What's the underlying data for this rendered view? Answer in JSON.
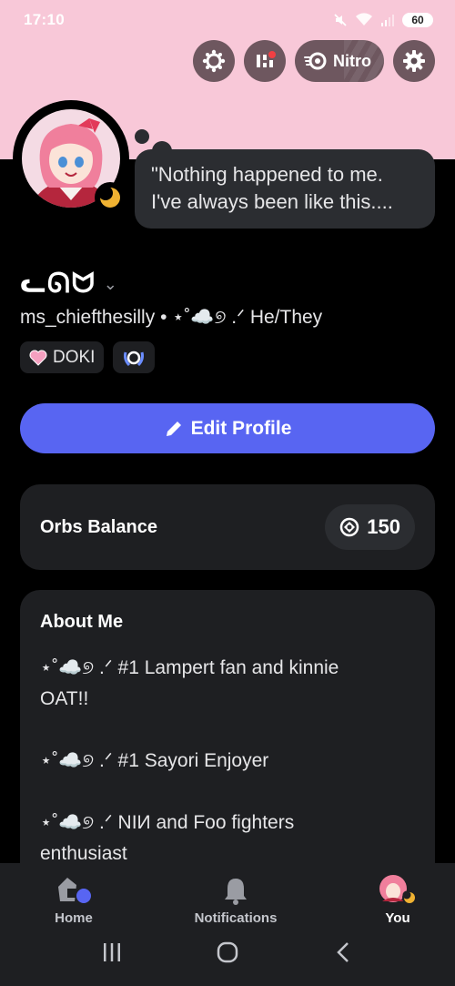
{
  "status_bar": {
    "time": "17:10",
    "battery": "60",
    "icons": [
      "mute-icon",
      "wifi-icon",
      "signal-icon",
      "battery-icon"
    ]
  },
  "header_actions": {
    "nitro_label": "Nitro",
    "icons": [
      "orbs-quest-icon",
      "shop-icon",
      "nitro-icon",
      "settings-icon"
    ]
  },
  "profile": {
    "status_bubble": "\"Nothing happened to me. I've always been like this....",
    "display_name": "ᓚᘏᗢ",
    "username": "ms_chiefthesilly",
    "separator": "•",
    "pronouns": "⋆˚☁️୭ .ᐟ He/They",
    "badges": [
      {
        "label": "DOKI",
        "icon": "heart-icon"
      },
      {
        "label": "",
        "icon": "laurel-badge-icon"
      }
    ],
    "presence": "idle",
    "colors": {
      "banner": "#f8c8d8",
      "accent": "#5865f2",
      "idle": "#f0b232"
    }
  },
  "edit_profile_label": "Edit Profile",
  "orbs": {
    "label": "Orbs Balance",
    "value": "150"
  },
  "about": {
    "title": "About Me",
    "lines": [
      "⋆˚☁️୭ .ᐟ #1 Lampert fan and kinnie",
      "OAT!!",
      "",
      "⋆˚☁️୭ .ᐟ #1 Sayori Enjoyer",
      "",
      "⋆˚☁️୭ .ᐟ NIИ and Foo fighters",
      "enthusiast"
    ]
  },
  "nav": {
    "tabs": [
      {
        "label": "Home",
        "icon": "home-icon",
        "active": false
      },
      {
        "label": "Notifications",
        "icon": "bell-icon",
        "active": false
      },
      {
        "label": "You",
        "icon": "avatar",
        "active": true
      }
    ]
  },
  "system_nav": [
    "recents-icon",
    "home-circle-icon",
    "back-icon"
  ]
}
